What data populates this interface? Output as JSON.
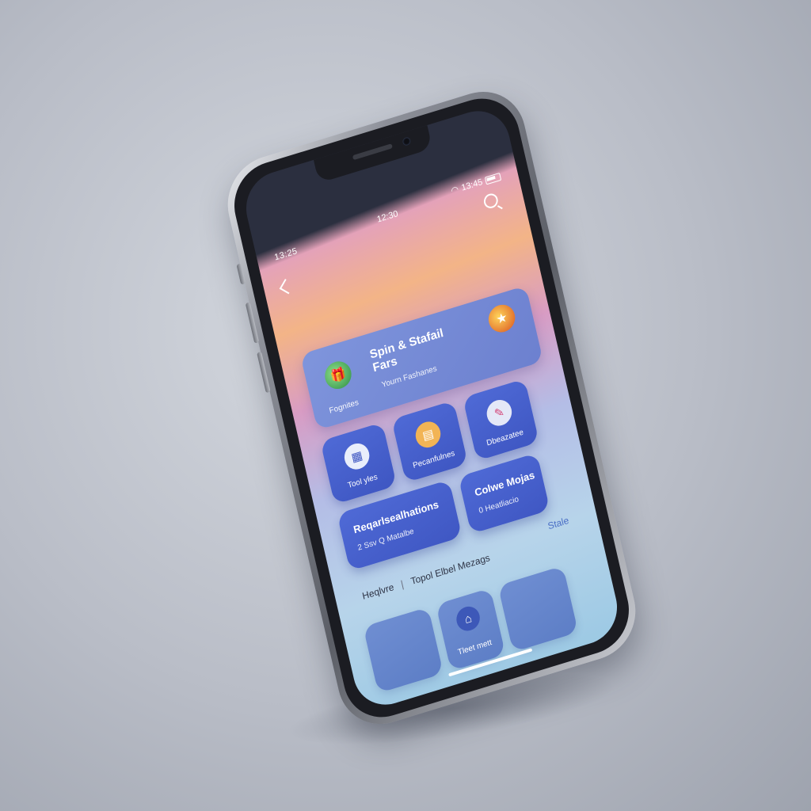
{
  "status_bar": {
    "left": "13:25",
    "center": "12:30",
    "right": "13:45"
  },
  "hero": {
    "title": "Spin & Stafail Fars",
    "subtitle": "Yourn Fashanes",
    "footer": "Fognites",
    "left_icon": "gift-box-icon",
    "right_icon": "badge-icon"
  },
  "tiles": [
    {
      "label": "Tool yles",
      "icon": "calendar-icon",
      "icon_bg": "#e9eefb",
      "glyph": "▦"
    },
    {
      "label": "Pecanfulnes",
      "icon": "document-icon",
      "icon_bg": "#f2b455",
      "glyph": "▤"
    },
    {
      "label": "Dbeazatee",
      "icon": "palette-icon",
      "icon_bg": "#e4e8f7",
      "glyph": "✎"
    }
  ],
  "wide_cards": [
    {
      "title": "Reqarlsealhations",
      "subtitle": "2 Ssv Q Matalbe"
    },
    {
      "title": "Colwe Mojas",
      "subtitle": "0 Heatliacio"
    }
  ],
  "section": {
    "left": "Heqlvre",
    "middle": "Topol Elbel Mezags",
    "right": "Stale"
  },
  "bottom_tiles": [
    {
      "label": ""
    },
    {
      "label": "Tleet mett",
      "icon": "home-icon"
    },
    {
      "label": ""
    }
  ],
  "colors": {
    "accent": "#4f6ad6",
    "card": "#7f95dc"
  }
}
